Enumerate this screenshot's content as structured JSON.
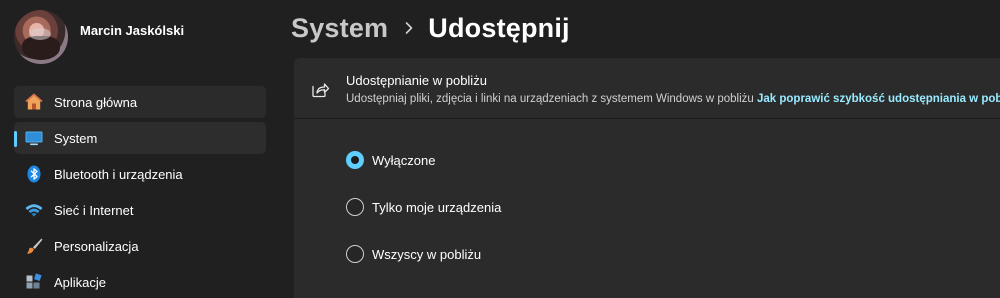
{
  "user": {
    "name": "Marcin Jaskólski"
  },
  "sidebar": {
    "items": [
      {
        "label": "Strona główna",
        "icon": "home-icon"
      },
      {
        "label": "System",
        "icon": "monitor-icon",
        "selected": true
      },
      {
        "label": "Bluetooth i urządzenia",
        "icon": "bluetooth-icon"
      },
      {
        "label": "Sieć i Internet",
        "icon": "wifi-icon"
      },
      {
        "label": "Personalizacja",
        "icon": "brush-icon"
      },
      {
        "label": "Aplikacje",
        "icon": "apps-icon"
      }
    ]
  },
  "breadcrumb": {
    "parent": "System",
    "current": "Udostępnij"
  },
  "nearby": {
    "title": "Udostępnianie w pobliżu",
    "description": "Udostępniaj pliki, zdjęcia i linki na urządzeniach z systemem Windows w pobliżu",
    "link": "Jak poprawić szybkość udostępniania w pobliżu",
    "options": [
      {
        "label": "Wyłączone",
        "selected": true
      },
      {
        "label": "Tylko moje urządzenia",
        "selected": false
      },
      {
        "label": "Wszyscy w pobliżu",
        "selected": false
      }
    ]
  },
  "colors": {
    "accent": "#60cdff",
    "link": "#99ebff",
    "background": "#202020",
    "card": "#2b2b2b"
  }
}
